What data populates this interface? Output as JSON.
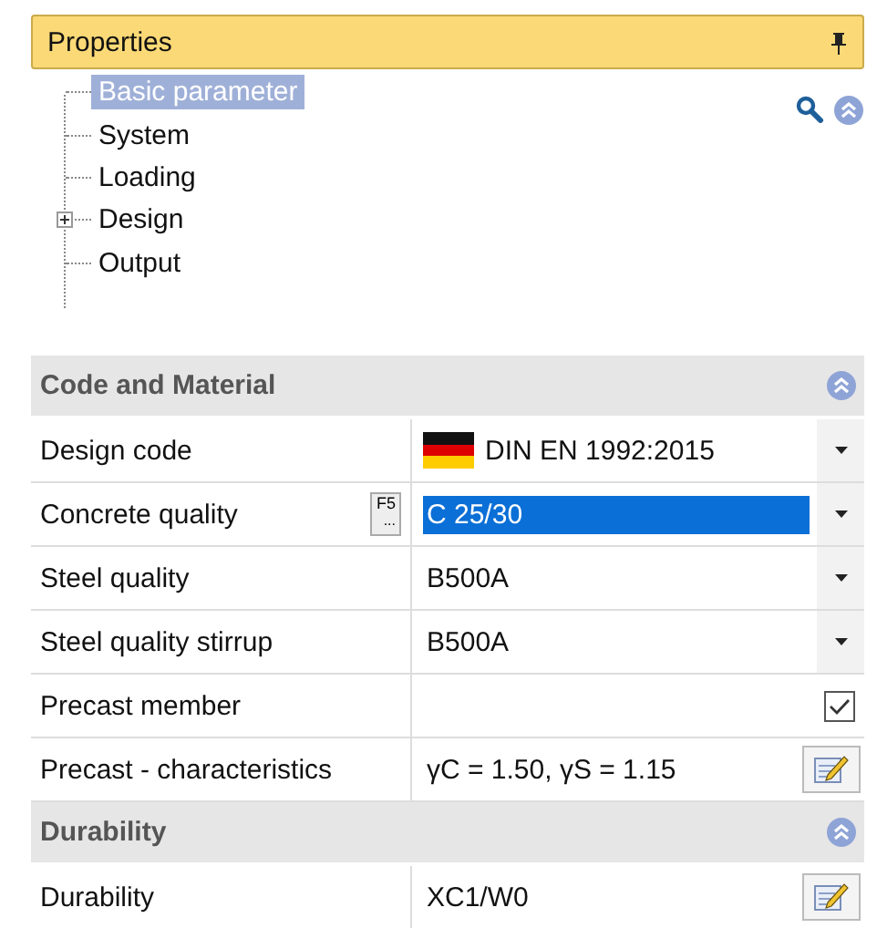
{
  "panel": {
    "title": "Properties"
  },
  "tree": [
    {
      "label": "Basic parameter",
      "selected": true
    },
    {
      "label": "System",
      "selected": false
    },
    {
      "label": "Loading",
      "selected": false
    },
    {
      "label": "Design",
      "selected": false,
      "expanded": false
    },
    {
      "label": "Output",
      "selected": false
    }
  ],
  "sections": [
    {
      "title": "Code and Material",
      "rows": [
        {
          "kind": "flag-dropdown",
          "label": "Design code",
          "value": "DIN EN 1992:2015",
          "selected": false
        },
        {
          "kind": "dropdown",
          "label": "Concrete quality",
          "value": "C 25/30",
          "selected": true,
          "shortcut": {
            "key": "F5",
            "more": "..."
          }
        },
        {
          "kind": "dropdown",
          "label": "Steel quality",
          "value": "B500A",
          "selected": false
        },
        {
          "kind": "dropdown",
          "label": "Steel quality stirrup",
          "value": "B500A",
          "selected": false
        },
        {
          "kind": "checkbox",
          "label": "Precast member",
          "checked": true,
          "selected": false
        },
        {
          "kind": "editor",
          "label": "Precast - characteristics",
          "value": "γC = 1.50, γS = 1.15",
          "selected": false
        }
      ]
    },
    {
      "title": "Durability",
      "rows": [
        {
          "kind": "editor",
          "label": "Durability",
          "value": "XC1/W0",
          "selected": false
        }
      ]
    }
  ]
}
